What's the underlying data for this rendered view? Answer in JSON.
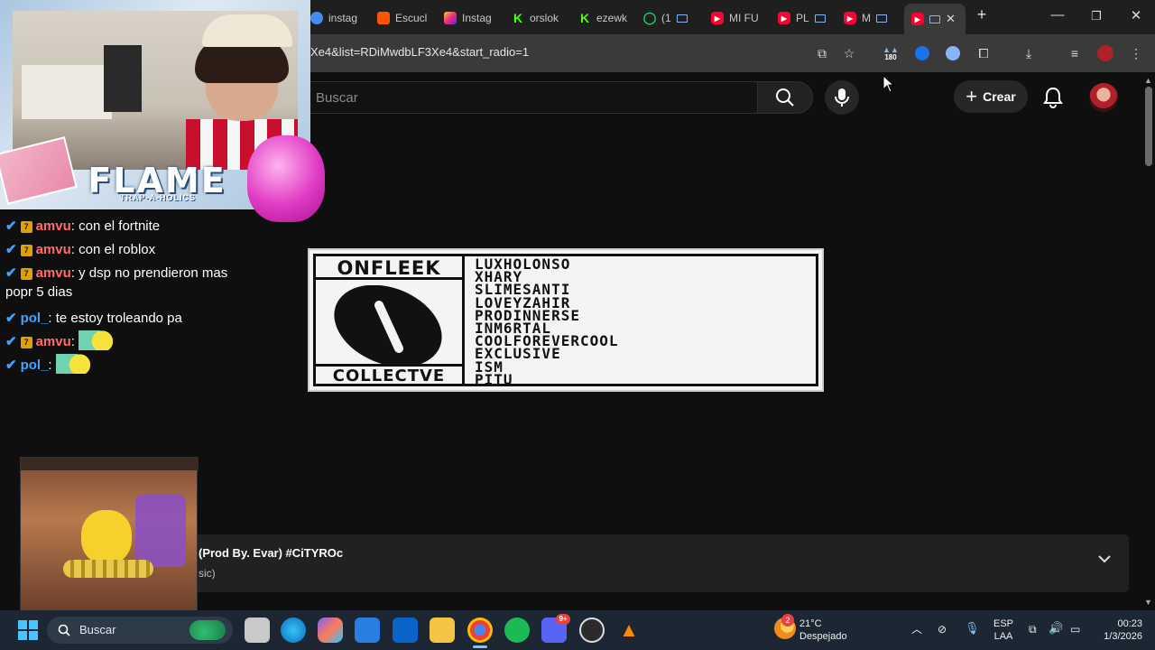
{
  "browser": {
    "tabs": [
      {
        "label": "instag",
        "icon": "chrome-icon"
      },
      {
        "label": "Escucl",
        "icon": "soundcloud-icon"
      },
      {
        "label": "Instag",
        "icon": "instagram-icon"
      },
      {
        "label": "orslok",
        "icon": "kick-icon"
      },
      {
        "label": "ezewk",
        "icon": "kick-icon"
      },
      {
        "label": "(1",
        "icon": "whatsapp-icon"
      },
      {
        "label": "MI FU",
        "icon": "youtube-icon"
      },
      {
        "label": "PL",
        "icon": "youtube-icon"
      },
      {
        "label": "M",
        "icon": "youtube-icon"
      },
      {
        "label": "",
        "icon": "youtube-icon",
        "active": true
      }
    ],
    "url": "Xe4&list=RDiMwdbLF3Xe4&start_radio=1",
    "extension_badge": "180"
  },
  "youtube": {
    "search_placeholder": "Buscar",
    "create_label": "Crear"
  },
  "artwork": {
    "brand_top": "ONFLEEK",
    "brand_bottom": "COLLECTVE",
    "roster": [
      "LUXHOLONSO",
      "XHARY",
      "SLIMESANTI",
      "LOVEYZAHIR",
      "PRODINNERSE",
      "INM6RTAL",
      "COOLFOREVERCOOL",
      "EXCLUSIVE",
      "ISM",
      "PITU"
    ]
  },
  "webcam": {
    "banner": "FLAME",
    "banner_sub": "TRAP-A-HOLICS"
  },
  "chat": [
    {
      "user": "amvu",
      "color": "#ff6b6b",
      "text": ": con el fortnite",
      "badge": true
    },
    {
      "user": "amvu",
      "color": "#ff6b6b",
      "text": ": con el roblox",
      "badge": true
    },
    {
      "user": "amvu",
      "color": "#ff6b6b",
      "text": ": y dsp no prendieron mas",
      "badge": true
    },
    {
      "user": "",
      "color": "#ffffff",
      "text": "popr 5 dias",
      "badge": false,
      "continuation": true
    },
    {
      "user": "pol_",
      "color": "#3ea6ff",
      "text": ": te estoy troleando pa",
      "badge": false
    },
    {
      "user": "amvu",
      "color": "#ff6b6b",
      "text": ":",
      "badge": true,
      "emote": true
    },
    {
      "user": "pol_",
      "color": "#3ea6ff",
      "text": ":",
      "badge": false,
      "emote": true
    }
  ],
  "player": {
    "title": "(Prod By. Evar) #CiTYROc",
    "subtitle": "sic)"
  },
  "taskbar": {
    "search_label": "Buscar",
    "weather_temp": "21°C",
    "weather_desc": "Despejado",
    "weather_badge": "2",
    "lang_1": "ESP",
    "lang_2": "LAA",
    "time": "00:23",
    "date": "1/3/2026",
    "discord_badge": "9+"
  },
  "colors": {
    "youtube_red": "#ff0033",
    "accent_blue": "#3ea6ff",
    "taskbar_bg": "#1c2733"
  }
}
